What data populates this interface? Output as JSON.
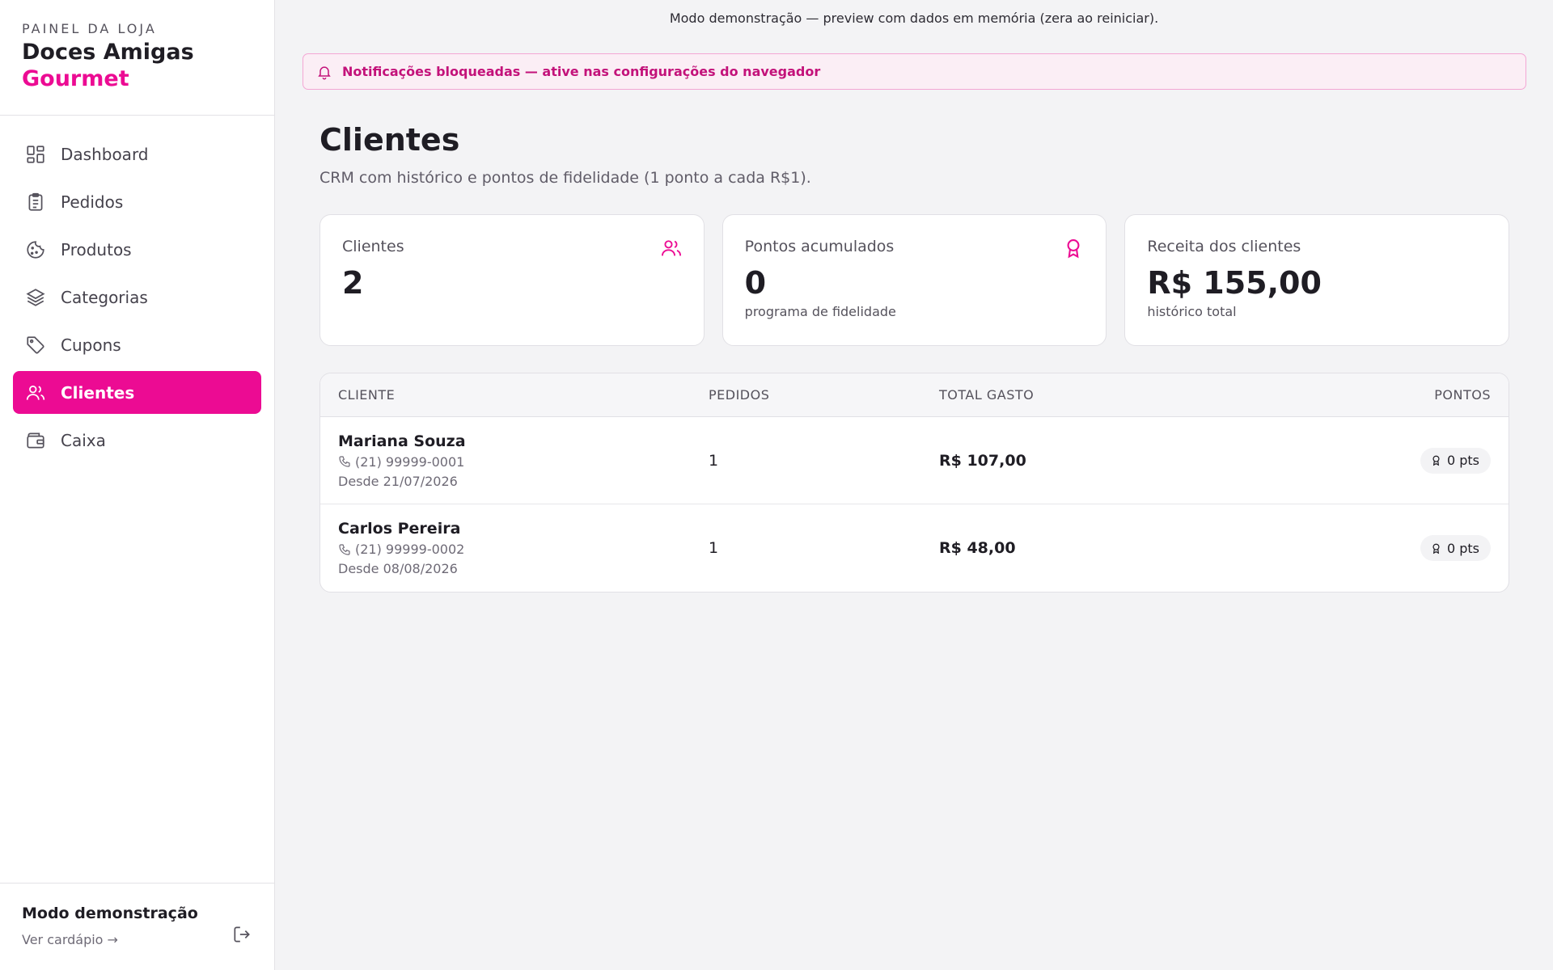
{
  "brand": {
    "kicker": "PAINEL DA LOJA",
    "name": "Doces Amigas",
    "accent": "Gourmet"
  },
  "nav": [
    {
      "label": "Dashboard",
      "icon": "dashboard-icon"
    },
    {
      "label": "Pedidos",
      "icon": "clipboard-icon"
    },
    {
      "label": "Produtos",
      "icon": "cookie-icon"
    },
    {
      "label": "Categorias",
      "icon": "layers-icon"
    },
    {
      "label": "Cupons",
      "icon": "tag-icon"
    },
    {
      "label": "Clientes",
      "icon": "users-icon",
      "active": true
    },
    {
      "label": "Caixa",
      "icon": "wallet-icon"
    }
  ],
  "footer": {
    "title": "Modo demonstração",
    "link": "Ver cardápio →"
  },
  "demo_bar": "Modo demonstração — preview com dados em memória (zera ao reiniciar).",
  "alert": "Notificações bloqueadas — ative nas configurações do navegador",
  "page": {
    "title": "Clientes",
    "subtitle": "CRM com histórico e pontos de fidelidade (1 ponto a cada R$1)."
  },
  "cards": [
    {
      "label": "Clientes",
      "value": "2",
      "note": "",
      "icon": "users-icon"
    },
    {
      "label": "Pontos acumulados",
      "value": "0",
      "note": "programa de fidelidade",
      "icon": "award-icon"
    },
    {
      "label": "Receita dos clientes",
      "value": "R$ 155,00",
      "note": "histórico total"
    }
  ],
  "table": {
    "headers": {
      "client": "CLIENTE",
      "orders": "PEDIDOS",
      "total": "TOTAL GASTO",
      "points": "PONTOS"
    },
    "rows": [
      {
        "name": "Mariana Souza",
        "phone": "(21) 99999-0001",
        "since": "Desde 21/07/2026",
        "orders": "1",
        "total": "R$ 107,00",
        "points": "0 pts"
      },
      {
        "name": "Carlos Pereira",
        "phone": "(21) 99999-0002",
        "since": "Desde 08/08/2026",
        "orders": "1",
        "total": "R$ 48,00",
        "points": "0 pts"
      }
    ]
  },
  "colors": {
    "accent": "#ec0b93",
    "background": "#f3f3f5"
  }
}
